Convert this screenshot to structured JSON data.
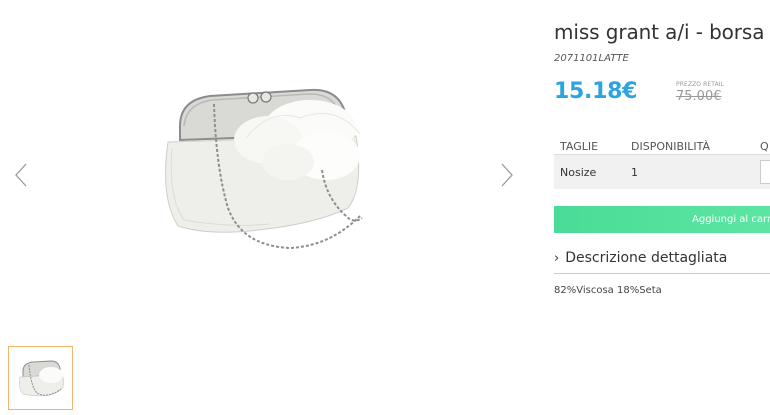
{
  "product": {
    "title": "miss grant a/i - borsa",
    "sku": "2071101LATTE",
    "price": "15.18€",
    "retail_label": "PREZZO RETAIL",
    "retail_price": "75.00€",
    "image_icon": "clutch-bag-image"
  },
  "sizes_table": {
    "headers": [
      "TAGLIE",
      "DISPONIBILITÀ",
      "Q"
    ],
    "rows": [
      {
        "size": "Nosize",
        "availability": "1"
      }
    ]
  },
  "cart": {
    "label": "Aggiungi al carr"
  },
  "description": {
    "toggle_label": "Descrizione dettagliata",
    "composition": "82%Viscosa 18%Seta"
  },
  "colors": {
    "price": "#2ea3e0",
    "cart_button": "#4fdf9b",
    "thumb_border": "#f0b46a"
  }
}
